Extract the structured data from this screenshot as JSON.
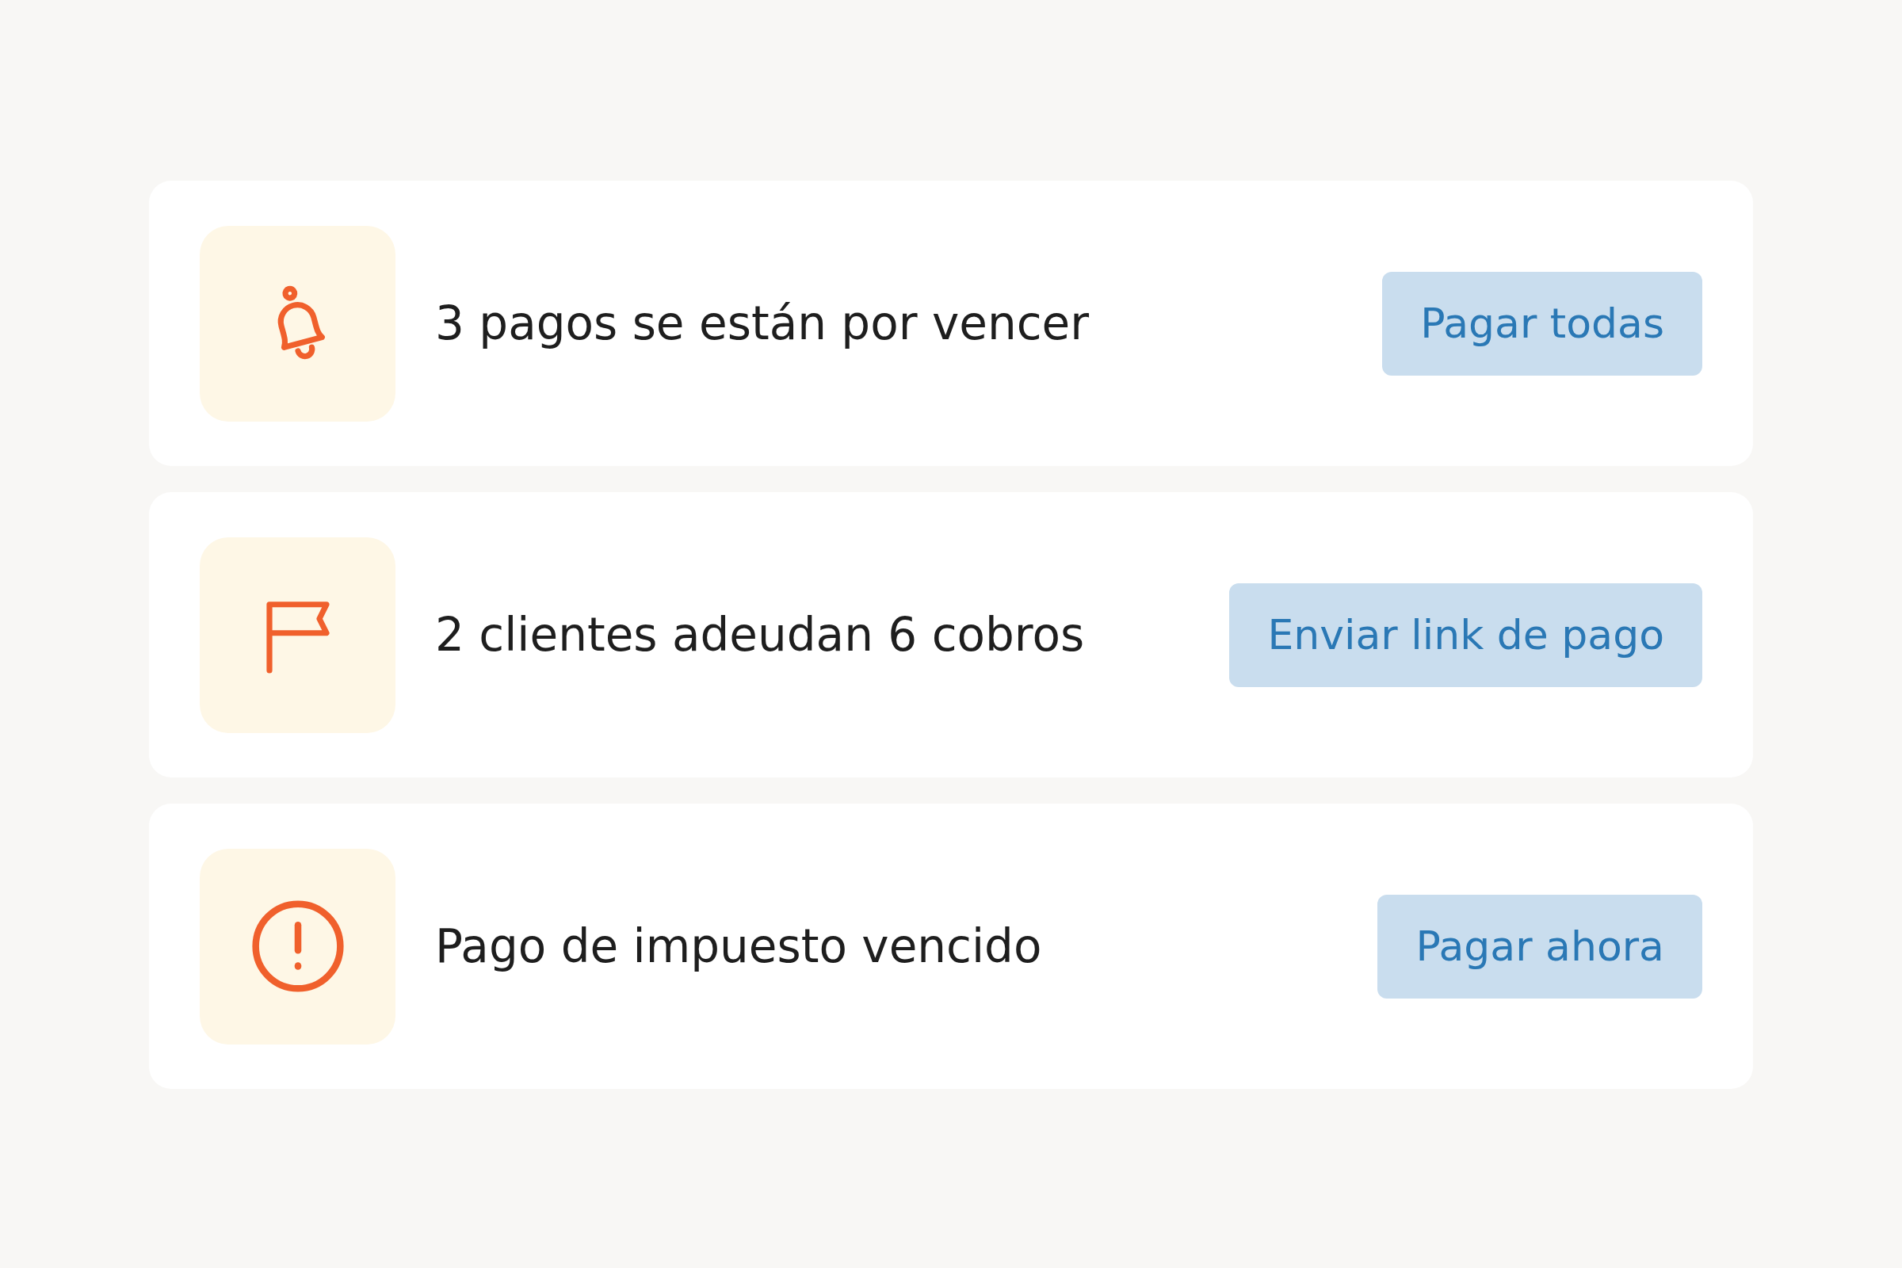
{
  "alerts": [
    {
      "kind": "bell",
      "message": "3 pagos se están por vencer",
      "action": "Pagar todas"
    },
    {
      "kind": "flag",
      "message": "2 clientes adeudan 6 cobros",
      "action": "Enviar link de pago"
    },
    {
      "kind": "alert",
      "message": "Pago de impuesto vencido",
      "action": "Pagar ahora"
    }
  ]
}
